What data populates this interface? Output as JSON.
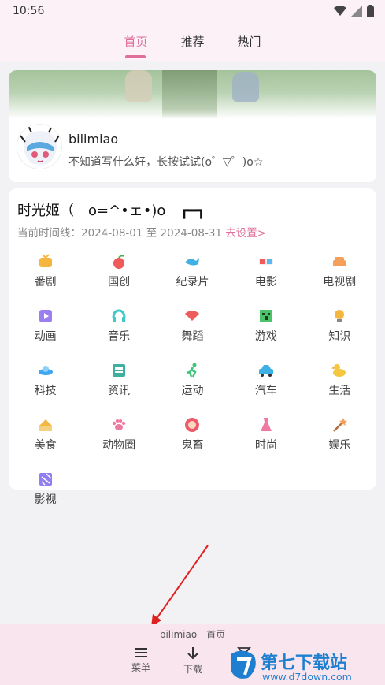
{
  "status": {
    "time": "10:56"
  },
  "tabs": [
    {
      "label": "首页",
      "active": true
    },
    {
      "label": "推荐",
      "active": false
    },
    {
      "label": "热门",
      "active": false
    }
  ],
  "user": {
    "name": "bilimiao",
    "signature": "不知道写什么好，长按试试(o゜▽゜)o☆"
  },
  "timeline": {
    "title": "时光姬（　o=^•ェ•)o　┏━┓",
    "range_label": "当前时间线：2024-08-01 至 2024-08-31",
    "set_link": "去设置>"
  },
  "categories": [
    {
      "label": "番剧",
      "icon": "tv-icon",
      "color": "#f5b640"
    },
    {
      "label": "国创",
      "icon": "peach-icon",
      "color": "#ef5a5a"
    },
    {
      "label": "纪录片",
      "icon": "whale-icon",
      "color": "#3fb0e6"
    },
    {
      "label": "电影",
      "icon": "3d-glasses-icon",
      "color": "#5ab8f0"
    },
    {
      "label": "电视剧",
      "icon": "sofa-icon",
      "color": "#f5a05a"
    },
    {
      "label": "动画",
      "icon": "play-icon",
      "color": "#9b7ff0"
    },
    {
      "label": "音乐",
      "icon": "headphones-icon",
      "color": "#3fc8c8"
    },
    {
      "label": "舞蹈",
      "icon": "fan-icon",
      "color": "#ef5a5a"
    },
    {
      "label": "游戏",
      "icon": "creeper-icon",
      "color": "#4cc26a"
    },
    {
      "label": "知识",
      "icon": "lightbulb-icon",
      "color": "#f5b640"
    },
    {
      "label": "科技",
      "icon": "ufo-icon",
      "color": "#3fa6f0"
    },
    {
      "label": "资讯",
      "icon": "news-icon",
      "color": "#3fb0a0"
    },
    {
      "label": "运动",
      "icon": "runner-icon",
      "color": "#3fc47a"
    },
    {
      "label": "汽车",
      "icon": "car-icon",
      "color": "#3fb0e6"
    },
    {
      "label": "生活",
      "icon": "duck-icon",
      "color": "#f5c640"
    },
    {
      "label": "美食",
      "icon": "cake-icon",
      "color": "#f5b640"
    },
    {
      "label": "动物圈",
      "icon": "paw-icon",
      "color": "#ef7aa0"
    },
    {
      "label": "鬼畜",
      "icon": "lion-icon",
      "color": "#ef5a6a"
    },
    {
      "label": "时尚",
      "icon": "dress-icon",
      "color": "#ef7aa0"
    },
    {
      "label": "娱乐",
      "icon": "magic-wand-icon",
      "color": "#f5a05a"
    },
    {
      "label": "影视",
      "icon": "clapper-icon",
      "color": "#8f7ff0"
    }
  ],
  "bottom": {
    "title": "bilimiao - 首页",
    "menu_label": "菜单",
    "download_label": "下载"
  },
  "watermark": {
    "name": "第七下载站",
    "url": "www.d7down.com"
  },
  "colors": {
    "accent": "#e0709b",
    "annotation": "#e02020"
  }
}
